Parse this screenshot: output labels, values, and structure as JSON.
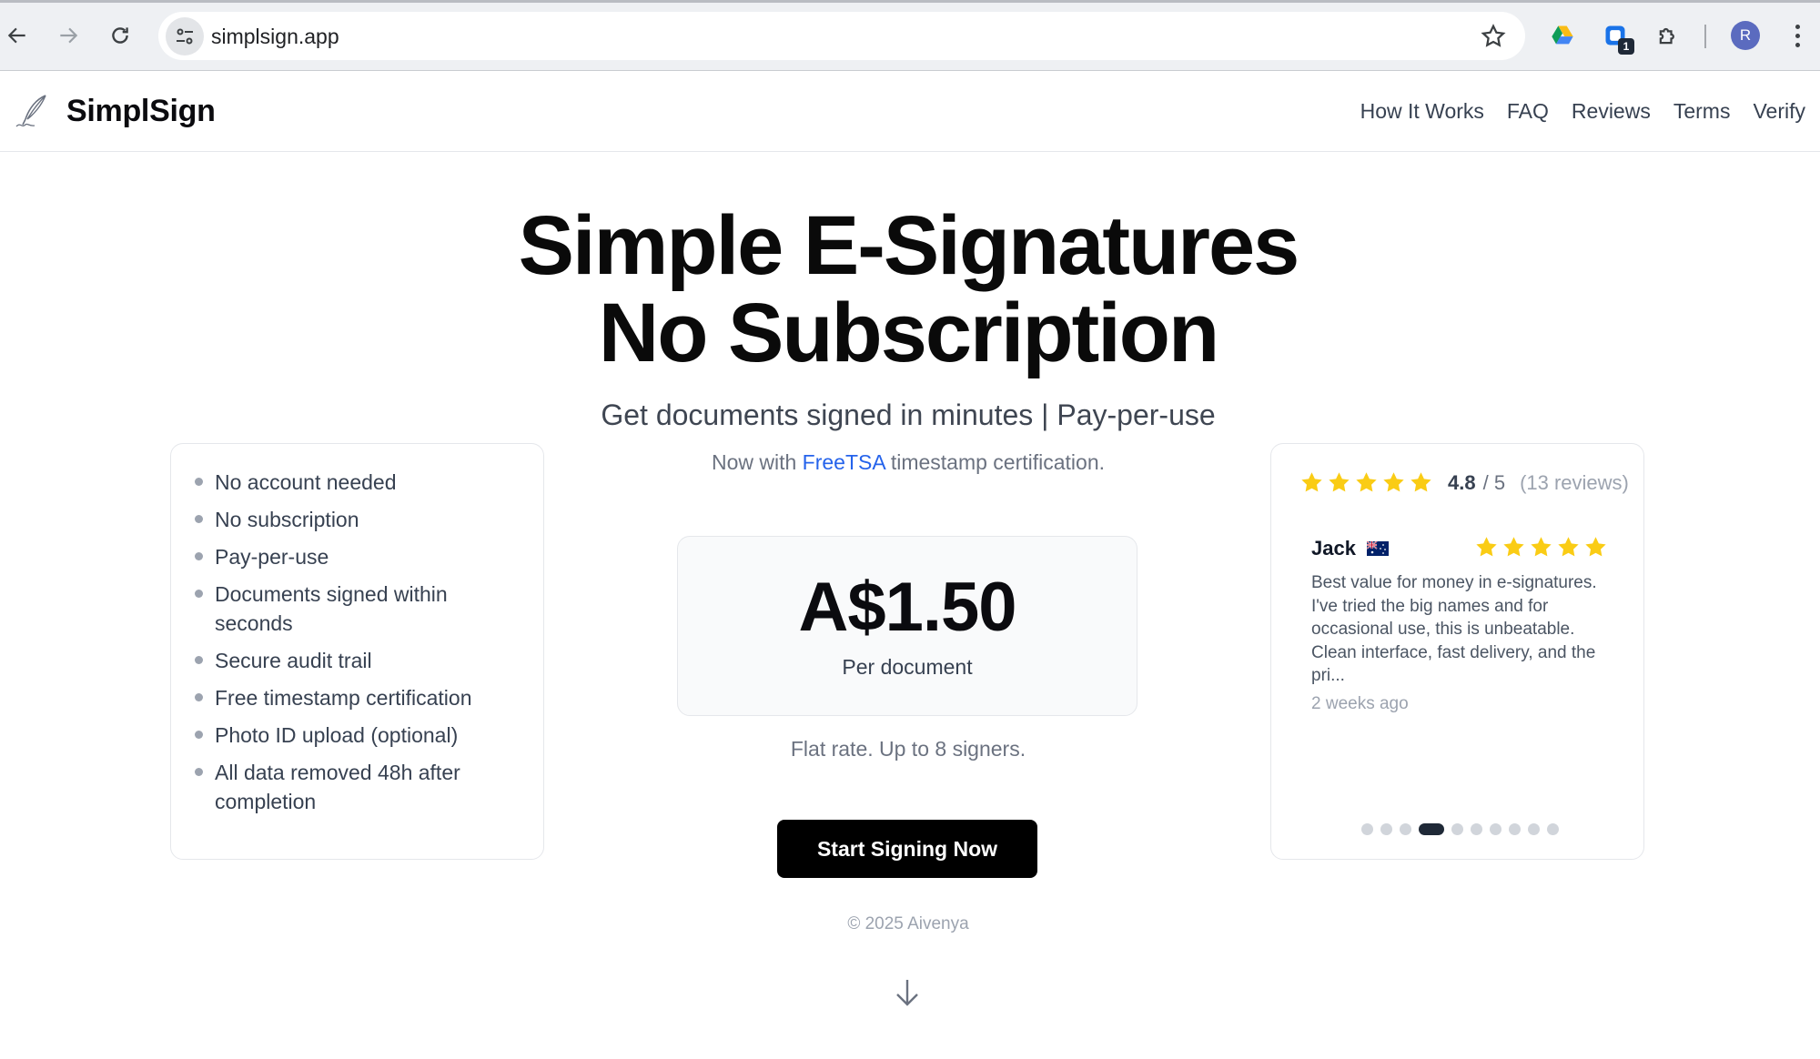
{
  "browser": {
    "url": "simplsign.app",
    "extension_badge": "1",
    "profile_initial": "R"
  },
  "header": {
    "brand": "SimplSign",
    "nav": [
      "How It Works",
      "FAQ",
      "Reviews",
      "Terms",
      "Verify"
    ]
  },
  "hero": {
    "title_line1": "Simple E-Signatures",
    "title_line2": "No Subscription",
    "subtitle": "Get documents signed in minutes | Pay-per-use",
    "note_prefix": "Now with ",
    "note_link": "FreeTSA",
    "note_suffix": " timestamp certification."
  },
  "features": [
    "No account needed",
    "No subscription",
    "Pay-per-use",
    "Documents signed within seconds",
    "Secure audit trail",
    "Free timestamp certification",
    "Photo ID upload (optional)",
    "All data removed 48h after completion"
  ],
  "pricing": {
    "amount": "A$1.50",
    "unit": "Per document",
    "note": "Flat rate. Up to 8 signers."
  },
  "cta": {
    "label": "Start Signing Now"
  },
  "footer": {
    "copyright": "© 2025 Aivenya"
  },
  "reviews": {
    "score": "4.8",
    "out_of": "/ 5",
    "count": "(13 reviews)",
    "rating_stars": 5,
    "current": {
      "name": "Jack",
      "flag": "australia-flag",
      "stars": 5,
      "text": "Best value for money in e-signatures. I've tried the big names and for occasional use, this is unbeatable. Clean interface, fast delivery, and the pri...",
      "time": "2 weeks ago"
    },
    "carousel": {
      "total": 10,
      "active_index": 3
    }
  },
  "colors": {
    "accent_link": "#2563eb",
    "star": "#facc15",
    "cta_bg": "#000000",
    "profile": "#5b6bbf"
  }
}
